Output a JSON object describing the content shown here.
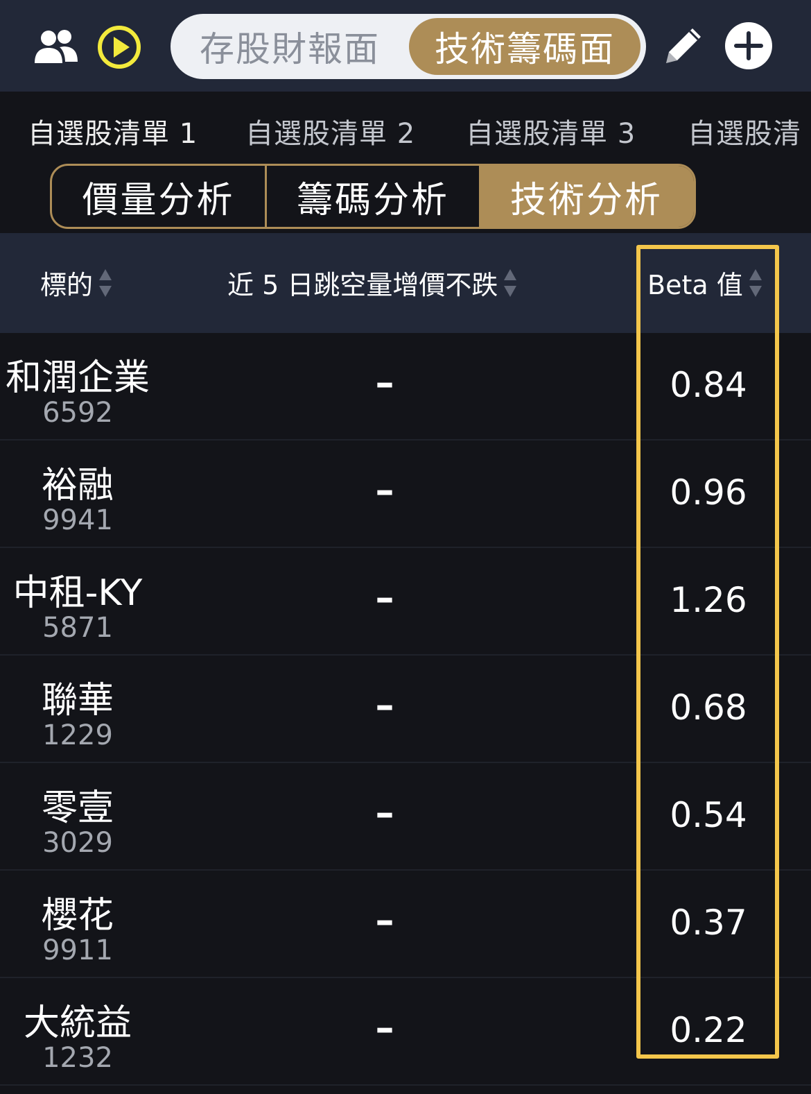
{
  "topbar": {
    "icons": [
      "people-icon",
      "play-circle-icon",
      "pencil-icon",
      "plus-circle-icon"
    ],
    "segments": [
      "存股財報面",
      "技術籌碼面"
    ],
    "active_segment": "技術籌碼面"
  },
  "watchlists": [
    "自選股清單 1",
    "自選股清單 2",
    "自選股清單 3",
    "自選股清"
  ],
  "analysis_tabs": [
    "價量分析",
    "籌碼分析",
    "技術分析"
  ],
  "active_analysis_tab": "技術分析",
  "table": {
    "columns": [
      "標的",
      "近 5 日跳空量增價不跌",
      "Beta 值"
    ],
    "rows": [
      {
        "name": "和潤企業",
        "code": "6592",
        "gap": "–",
        "beta": "0.84"
      },
      {
        "name": "裕融",
        "code": "9941",
        "gap": "–",
        "beta": "0.96"
      },
      {
        "name": "中租-KY",
        "code": "5871",
        "gap": "–",
        "beta": "1.26"
      },
      {
        "name": "聯華",
        "code": "1229",
        "gap": "–",
        "beta": "0.68"
      },
      {
        "name": "零壹",
        "code": "3029",
        "gap": "–",
        "beta": "0.54"
      },
      {
        "name": "櫻花",
        "code": "9911",
        "gap": "–",
        "beta": "0.37"
      },
      {
        "name": "大統益",
        "code": "1232",
        "gap": "–",
        "beta": "0.22"
      }
    ]
  },
  "colors": {
    "accent_gold": "#ad8d57",
    "highlight_yellow": "#f4c64b",
    "header_bg": "#222838",
    "body_bg": "#131419"
  }
}
